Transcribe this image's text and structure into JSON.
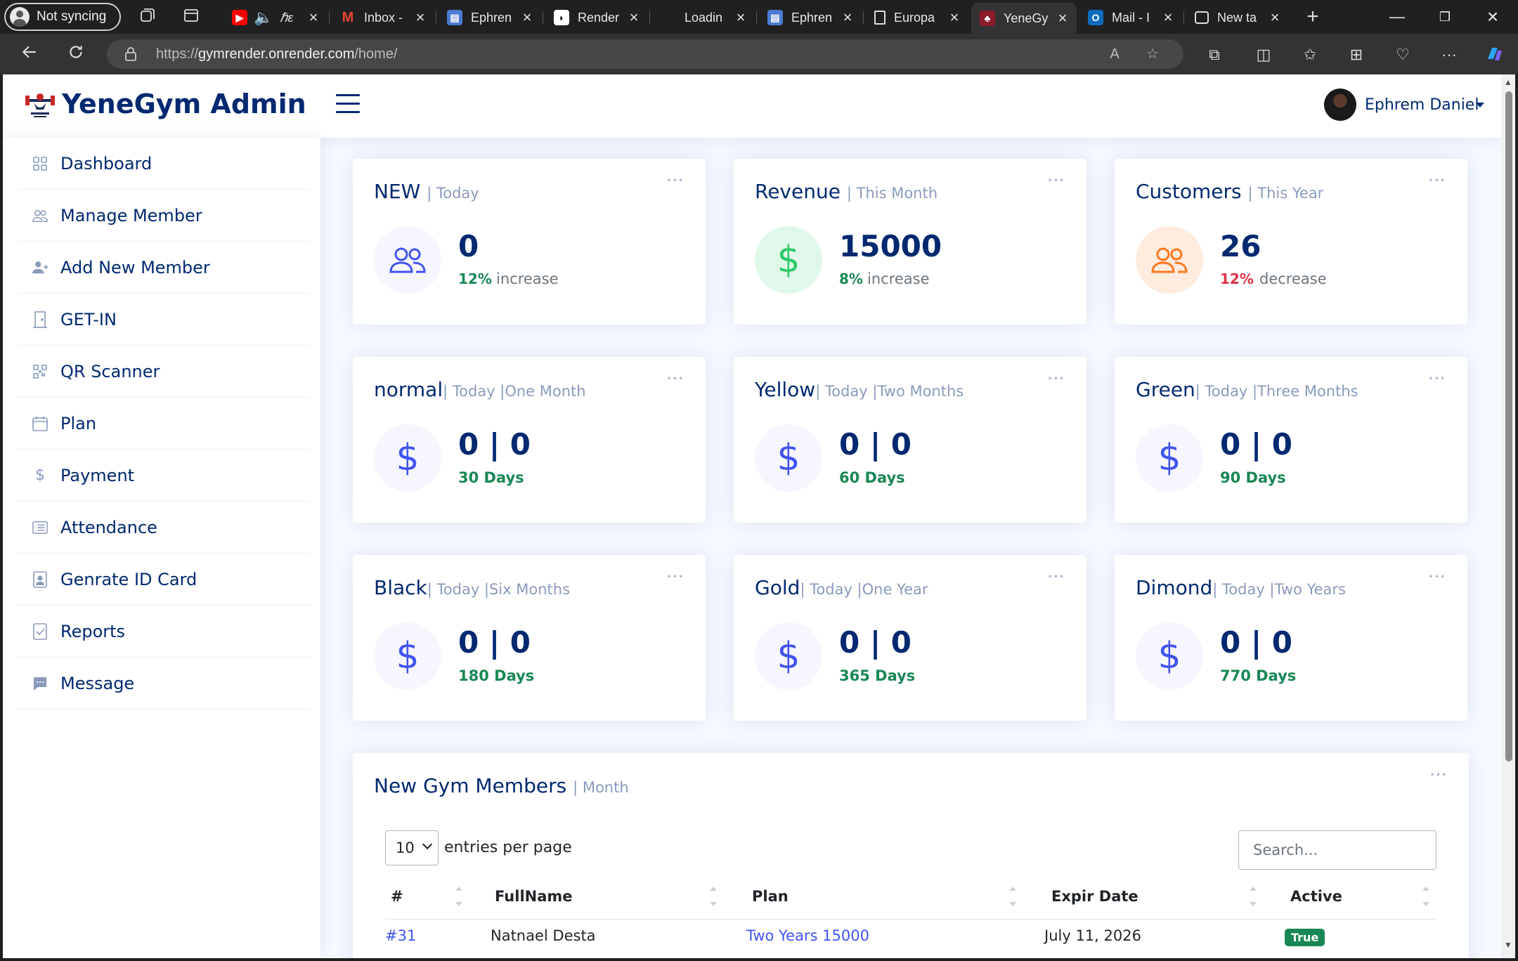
{
  "browser": {
    "profile_label": "Not syncing",
    "tabs": [
      {
        "label": "",
        "icon": "youtube-icon"
      },
      {
        "label": "Inbox -",
        "icon": "gmail-icon"
      },
      {
        "label": "Ephren",
        "icon": "document-icon"
      },
      {
        "label": "Render",
        "icon": "render-icon"
      },
      {
        "label": "Loadin",
        "icon": "loading-icon"
      },
      {
        "label": "Ephren",
        "icon": "document-icon"
      },
      {
        "label": "Europa",
        "icon": "page-icon"
      },
      {
        "label": "YeneGy",
        "icon": "gym-icon"
      },
      {
        "label": "Mail - I",
        "icon": "outlook-icon"
      },
      {
        "label": "New ta",
        "icon": "newtab-icon"
      }
    ],
    "url_prefix": "https://",
    "url_host": "gymrender.onrender.com",
    "url_path": "/home/"
  },
  "header": {
    "app_title": "YeneGym Admin",
    "user_name": "Ephrem Daniel"
  },
  "sidebar": {
    "items": [
      {
        "label": "Dashboard",
        "icon": "grid-icon"
      },
      {
        "label": "Manage Member",
        "icon": "people-icon"
      },
      {
        "label": "Add New Member",
        "icon": "person-add-icon"
      },
      {
        "label": "GET-IN",
        "icon": "door-icon"
      },
      {
        "label": "QR Scanner",
        "icon": "qr-icon"
      },
      {
        "label": "Plan",
        "icon": "calendar-icon"
      },
      {
        "label": "Payment",
        "icon": "dollar-icon"
      },
      {
        "label": "Attendance",
        "icon": "list-card-icon"
      },
      {
        "label": "Genrate ID Card",
        "icon": "id-card-icon"
      },
      {
        "label": "Reports",
        "icon": "check-file-icon"
      },
      {
        "label": "Message",
        "icon": "chat-icon"
      }
    ]
  },
  "stats": [
    {
      "title": "NEW",
      "subtitle": "| Today",
      "value": "0",
      "pct": "12%",
      "trend": "increase",
      "trend_color": "#198754",
      "icon": "people-icon",
      "circle_bg": "#f6f6fe",
      "icon_color": "#4154f1"
    },
    {
      "title": "Revenue",
      "subtitle": "| This Month",
      "value": "15000",
      "pct": "8%",
      "trend": "increase",
      "trend_color": "#198754",
      "icon": "dollar-icon",
      "circle_bg": "#e0f8e9",
      "icon_color": "#2eca6a"
    },
    {
      "title": "Customers",
      "subtitle": "| This Year",
      "value": "26",
      "pct": "12%",
      "trend": "decrease",
      "trend_color": "#dc3545",
      "icon": "people-icon",
      "circle_bg": "#ffecdf",
      "icon_color": "#ff771d"
    }
  ],
  "plans": [
    {
      "title": "normal",
      "subtitle": "| Today |One Month",
      "value": "0 | 0",
      "days": "30 Days"
    },
    {
      "title": "Yellow",
      "subtitle": "| Today |Two Months",
      "value": "0 | 0",
      "days": "60 Days"
    },
    {
      "title": "Green",
      "subtitle": "| Today |Three Months",
      "value": "0 | 0",
      "days": "90 Days"
    },
    {
      "title": "Black",
      "subtitle": "| Today |Six Months",
      "value": "0 | 0",
      "days": "180 Days"
    },
    {
      "title": "Gold",
      "subtitle": "| Today |One Year",
      "value": "0 | 0",
      "days": "365 Days"
    },
    {
      "title": "Dimond",
      "subtitle": "| Today |Two Years",
      "value": "0 | 0",
      "days": "770 Days"
    }
  ],
  "members_table": {
    "title": "New Gym Members",
    "subtitle": "| Month",
    "per_page_value": "10",
    "per_page_label": "entries per page",
    "search_placeholder": "Search...",
    "columns": [
      "#",
      "FullName",
      "Plan",
      "Expir Date",
      "Active"
    ],
    "rows": [
      {
        "id": "#31",
        "name": "Natnael Desta",
        "plan": "Two Years 15000",
        "expiry": "July 11, 2026",
        "active": "True"
      }
    ]
  },
  "colors": {
    "primary": "#012970",
    "accent": "#4154f1",
    "muted": "#899bbd",
    "success": "#198754",
    "danger": "#dc3545"
  }
}
